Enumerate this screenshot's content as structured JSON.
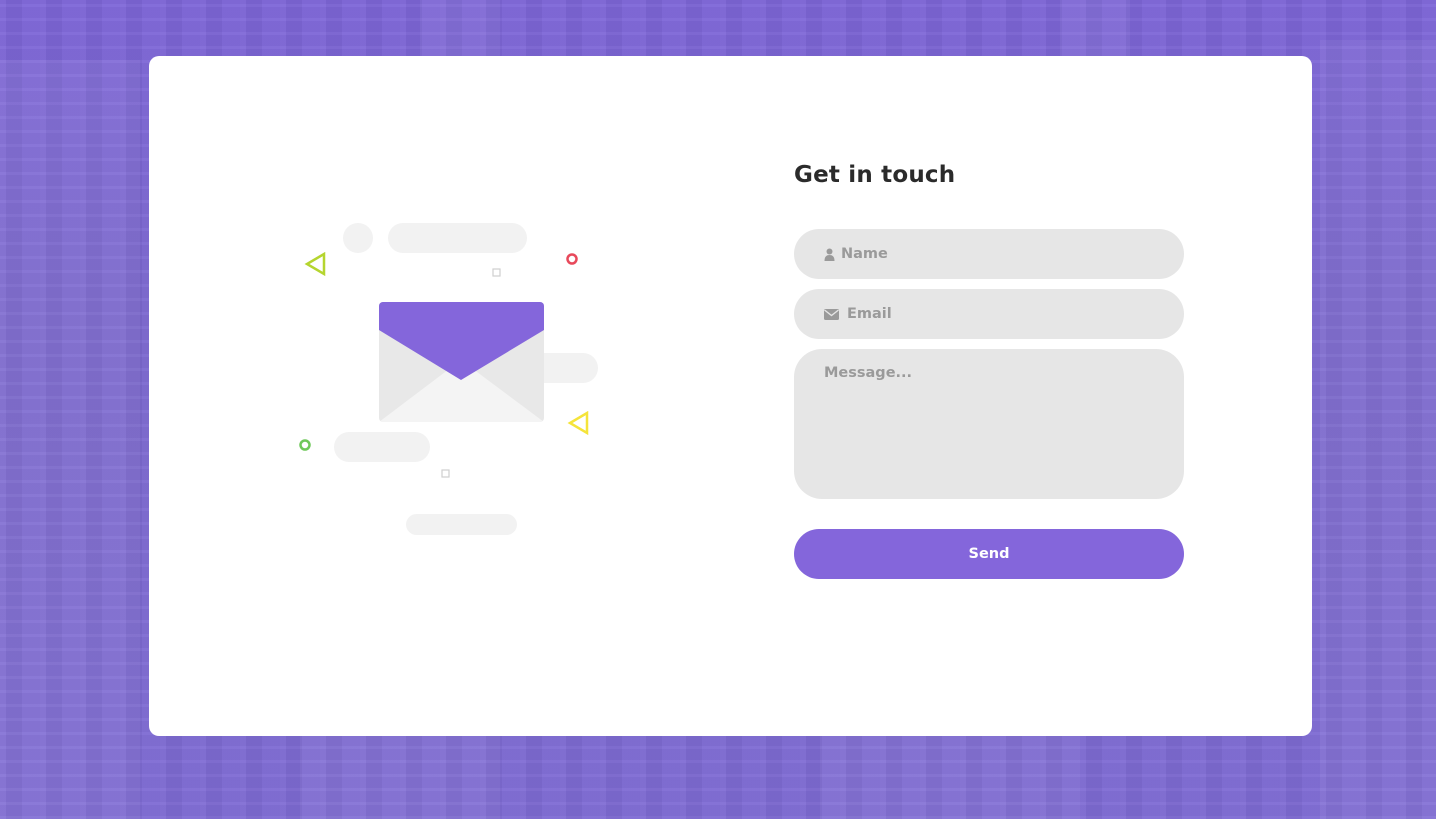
{
  "colors": {
    "accent": "#8466db",
    "background": "#7f68d6",
    "card": "#ffffff",
    "field": "#e6e6e6",
    "title": "#2b2b2b",
    "decor_green_lime": "#b5d52f",
    "decor_red": "#e8495b",
    "decor_yellow": "#f5e43a",
    "decor_green": "#6fc85a"
  },
  "contact": {
    "title": "Get in touch",
    "name_placeholder": "Name",
    "name_icon": "user-icon",
    "email_placeholder": "Email",
    "email_icon": "envelope-icon",
    "message_placeholder": "Message...",
    "send_label": "Send"
  },
  "illustration": {
    "icon": "envelope-illustration"
  }
}
